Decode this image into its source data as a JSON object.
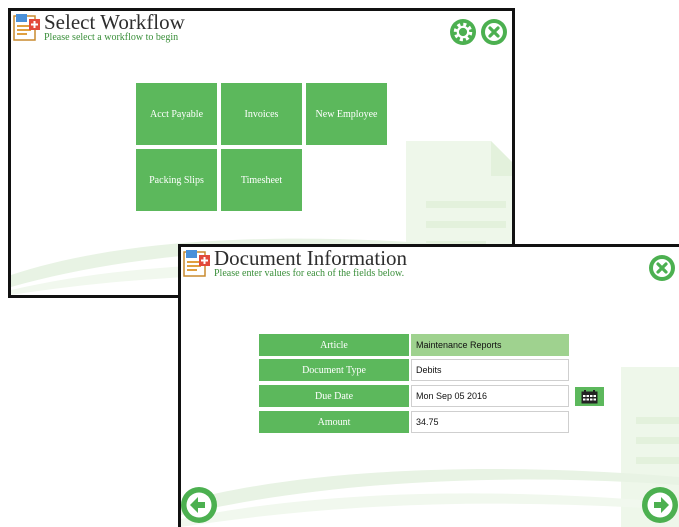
{
  "colors": {
    "accent": "#5cb85c",
    "readonly_field": "#9fd28f",
    "title_text": "#2e2e2e",
    "subtitle_text": "#3a8f3a"
  },
  "select_workflow": {
    "title": "Select Workflow",
    "subtitle": "Please select a workflow to begin",
    "icons": [
      "app-icon",
      "gear-icon",
      "close-icon"
    ],
    "workflows": [
      "Acct Payable",
      "Invoices",
      "New Employee",
      "Packing Slips",
      "Timesheet"
    ]
  },
  "document_information": {
    "title": "Document Information",
    "subtitle": "Please enter values for each of the fields below.",
    "icons": [
      "app-icon",
      "close-icon",
      "calendar-icon",
      "arrow-left-icon",
      "arrow-right-icon"
    ],
    "fields": [
      {
        "label": "Article",
        "value": "Maintenance Reports"
      },
      {
        "label": "Document Type",
        "value": "Debits"
      },
      {
        "label": "Due Date",
        "value": "Mon Sep 05 2016"
      },
      {
        "label": "Amount",
        "value": "34.75"
      }
    ]
  }
}
